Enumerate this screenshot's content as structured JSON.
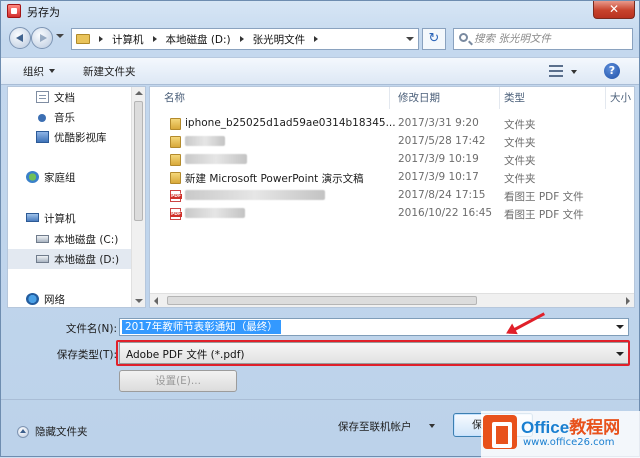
{
  "window": {
    "title": "另存为",
    "close_glyph": "✕"
  },
  "address": {
    "crumbs": [
      "计算机",
      "本地磁盘 (D:)",
      "张光明文件"
    ],
    "refresh_glyph": "↻"
  },
  "search": {
    "placeholder": "搜索 张光明文件"
  },
  "toolbar": {
    "organize": "组织",
    "new_folder": "新建文件夹",
    "help": "?"
  },
  "nav": {
    "items": [
      {
        "label": "文档",
        "icon": "document-icon"
      },
      {
        "label": "音乐",
        "icon": "music-icon"
      },
      {
        "label": "优酷影视库",
        "icon": "video-library-icon"
      },
      {
        "label": "家庭组",
        "icon": "homegroup-icon"
      },
      {
        "label": "计算机",
        "icon": "computer-icon"
      },
      {
        "label": "本地磁盘 (C:)",
        "icon": "drive-icon"
      },
      {
        "label": "本地磁盘 (D:)",
        "icon": "drive-icon",
        "selected": true
      },
      {
        "label": "网络",
        "icon": "network-icon"
      }
    ]
  },
  "filelist": {
    "columns": {
      "name": "名称",
      "modified": "修改日期",
      "type": "类型",
      "size": "大小"
    },
    "rows": [
      {
        "name": "iphone_b25025d1ad59ae0314b18345...",
        "date": "2017/3/31 9:20",
        "type": "文件夹",
        "icon": "folder-icon"
      },
      {
        "name": "",
        "date": "2017/5/28 17:42",
        "type": "文件夹",
        "icon": "folder-icon"
      },
      {
        "name": "",
        "date": "2017/3/9 10:19",
        "type": "文件夹",
        "icon": "folder-icon"
      },
      {
        "name": "新建 Microsoft PowerPoint 演示文稿",
        "date": "2017/3/9 10:17",
        "type": "文件夹",
        "icon": "folder-icon"
      },
      {
        "name": "",
        "date": "2017/8/24 17:15",
        "type": "看图王 PDF 文件",
        "icon": "pdf-icon"
      },
      {
        "name": "",
        "date": "2016/10/22 16:45",
        "type": "看图王 PDF 文件",
        "icon": "pdf-icon"
      }
    ]
  },
  "form": {
    "filename_label": "文件名(N):",
    "filename_value": "2017年教师节表彰通知（最终）",
    "filetype_label": "保存类型(T):",
    "filetype_value": "Adobe PDF 文件 (*.pdf)",
    "settings_label": "设置(E)..."
  },
  "footer": {
    "hide_folders": "隐藏文件夹",
    "save_online": "保存至联机帐户",
    "save_button": "保"
  },
  "watermark": {
    "brand_en": "Office",
    "brand_cn": "教程网",
    "url": "www.office26.com"
  },
  "colors": {
    "highlight": "#e0202a",
    "selection": "#3399ff"
  }
}
